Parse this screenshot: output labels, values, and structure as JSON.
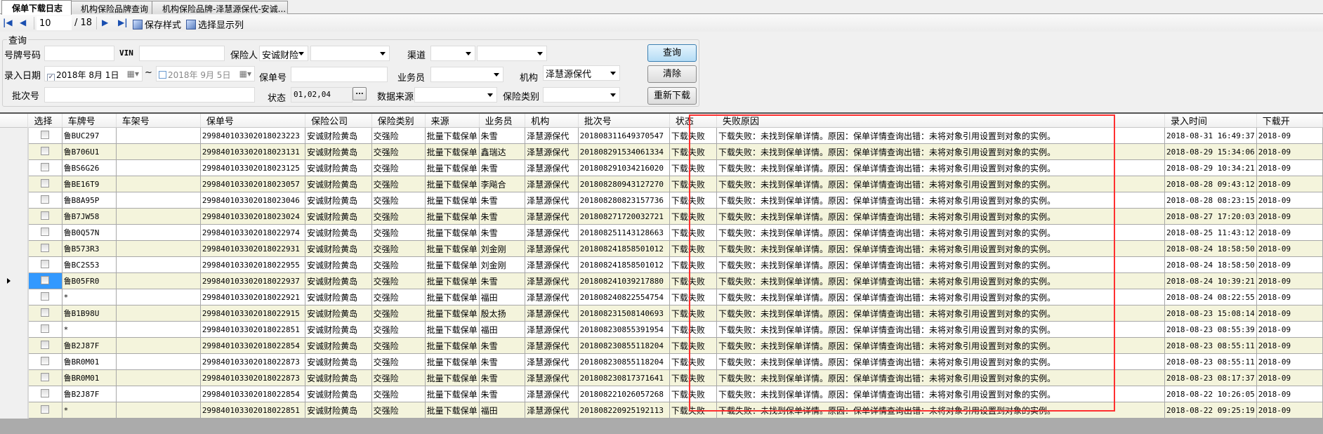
{
  "tabs": [
    {
      "label": "保单下载日志",
      "active": true
    },
    {
      "label": "机构保险品牌查询"
    },
    {
      "label": "机构保险品牌-泽慧源保代-安诚..."
    }
  ],
  "toolbar": {
    "current_page": "10",
    "total_pages": "/ 18",
    "save_style": "保存样式",
    "select_columns": "选择显示列"
  },
  "query": {
    "group_title": "查询",
    "plate_label": "号牌号码",
    "plate_value": "",
    "vin_label": "VIN",
    "vin_value": "",
    "insurer_label": "保险人",
    "insurer_value": "安诚财险",
    "insurer_sub_value": "",
    "channel_label": "渠道",
    "channel_value": "",
    "channel_sub_value": "",
    "entry_date_label": "录入日期",
    "date_from": "2018年  8月  1日",
    "date_from_checked": true,
    "tilde": "~",
    "date_to": "2018年  9月  5日",
    "date_to_checked": false,
    "policy_label": "保单号",
    "policy_value": "",
    "salesman_label": "业务员",
    "salesman_value": "",
    "org_label": "机构",
    "org_value": "泽慧源保代",
    "batch_label": "批次号",
    "batch_value": "",
    "status_label": "状态",
    "status_value": "01,02,04",
    "ellipsis": "...",
    "source_label": "数据来源",
    "source_value": "",
    "category_label": "保险类别",
    "category_value": "",
    "search_button": "查询",
    "clear_button": "清除",
    "redownload_button": "重新下载"
  },
  "grid": {
    "columns": [
      "选择",
      "车牌号",
      "车架号",
      "保单号",
      "保险公司",
      "保险类别",
      "来源",
      "业务员",
      "机构",
      "批次号",
      "状态",
      "失败原因",
      "录入时间",
      "下载开"
    ],
    "selected_row": 9,
    "rows": [
      [
        "鲁BUC297",
        "",
        "299840103302018023223",
        "安诚财险黄岛",
        "交强险",
        "批量下载保单",
        "朱雪",
        "泽慧源保代",
        "201808311649370547",
        "下载失败",
        "下载失败：未找到保单详情。原因：保单详情查询出错：未将对象引用设置到对象的实例。",
        "2018-08-31 16:49:37",
        "2018-09"
      ],
      [
        "鲁B706U1",
        "",
        "299840103302018023131",
        "安诚财险黄岛",
        "交强险",
        "批量下载保单",
        "鑫瑞达",
        "泽慧源保代",
        "201808291534061334",
        "下载失败",
        "下载失败：未找到保单详情。原因：保单详情查询出错：未将对象引用设置到对象的实例。",
        "2018-08-29 15:34:06",
        "2018-09"
      ],
      [
        "鲁BS6G26",
        "",
        "299840103302018023125",
        "安诚财险黄岛",
        "交强险",
        "批量下载保单",
        "朱雪",
        "泽慧源保代",
        "201808291034216020",
        "下载失败",
        "下载失败：未找到保单详情。原因：保单详情查询出错：未将对象引用设置到对象的实例。",
        "2018-08-29 10:34:21",
        "2018-09"
      ],
      [
        "鲁BE16T9",
        "",
        "299840103302018023057",
        "安诚财险黄岛",
        "交强险",
        "批量下载保单",
        "李飚合",
        "泽慧源保代",
        "201808280943127270",
        "下载失败",
        "下载失败：未找到保单详情。原因：保单详情查询出错：未将对象引用设置到对象的实例。",
        "2018-08-28 09:43:12",
        "2018-09"
      ],
      [
        "鲁B8A95P",
        "",
        "299840103302018023046",
        "安诚财险黄岛",
        "交强险",
        "批量下载保单",
        "朱雪",
        "泽慧源保代",
        "201808280823157736",
        "下载失败",
        "下载失败：未找到保单详情。原因：保单详情查询出错：未将对象引用设置到对象的实例。",
        "2018-08-28 08:23:15",
        "2018-09"
      ],
      [
        "鲁B7JW58",
        "",
        "299840103302018023024",
        "安诚财险黄岛",
        "交强险",
        "批量下载保单",
        "朱雪",
        "泽慧源保代",
        "201808271720032721",
        "下载失败",
        "下载失败：未找到保单详情。原因：保单详情查询出错：未将对象引用设置到对象的实例。",
        "2018-08-27 17:20:03",
        "2018-09"
      ],
      [
        "鲁B0Q57N",
        "",
        "299840103302018022974",
        "安诚财险黄岛",
        "交强险",
        "批量下载保单",
        "朱雪",
        "泽慧源保代",
        "201808251143128663",
        "下载失败",
        "下载失败：未找到保单详情。原因：保单详情查询出错：未将对象引用设置到对象的实例。",
        "2018-08-25 11:43:12",
        "2018-09"
      ],
      [
        "鲁B573R3",
        "",
        "299840103302018022931",
        "安诚财险黄岛",
        "交强险",
        "批量下载保单",
        "刘金刚",
        "泽慧源保代",
        "201808241858501012",
        "下载失败",
        "下载失败：未找到保单详情。原因：保单详情查询出错：未将对象引用设置到对象的实例。",
        "2018-08-24 18:58:50",
        "2018-09"
      ],
      [
        "鲁BC2S53",
        "",
        "299840103302018022955",
        "安诚财险黄岛",
        "交强险",
        "批量下载保单",
        "刘金刚",
        "泽慧源保代",
        "201808241858501012",
        "下载失败",
        "下载失败：未找到保单详情。原因：保单详情查询出错：未将对象引用设置到对象的实例。",
        "2018-08-24 18:58:50",
        "2018-09"
      ],
      [
        "鲁B05FR0",
        "",
        "299840103302018022937",
        "安诚财险黄岛",
        "交强险",
        "批量下载保单",
        "朱雪",
        "泽慧源保代",
        "201808241039217880",
        "下载失败",
        "下载失败：未找到保单详情。原因：保单详情查询出错：未将对象引用设置到对象的实例。",
        "2018-08-24 10:39:21",
        "2018-09"
      ],
      [
        "*",
        "",
        "299840103302018022921",
        "安诚财险黄岛",
        "交强险",
        "批量下载保单",
        "福田",
        "泽慧源保代",
        "201808240822554754",
        "下载失败",
        "下载失败：未找到保单详情。原因：保单详情查询出错：未将对象引用设置到对象的实例。",
        "2018-08-24 08:22:55",
        "2018-09"
      ],
      [
        "鲁B1B98U",
        "",
        "299840103302018022915",
        "安诚财险黄岛",
        "交强险",
        "批量下载保单",
        "殷太扬",
        "泽慧源保代",
        "201808231508140693",
        "下载失败",
        "下载失败：未找到保单详情。原因：保单详情查询出错：未将对象引用设置到对象的实例。",
        "2018-08-23 15:08:14",
        "2018-09"
      ],
      [
        "*",
        "",
        "299840103302018022851",
        "安诚财险黄岛",
        "交强险",
        "批量下载保单",
        "福田",
        "泽慧源保代",
        "201808230855391954",
        "下载失败",
        "下载失败：未找到保单详情。原因：保单详情查询出错：未将对象引用设置到对象的实例。",
        "2018-08-23 08:55:39",
        "2018-09"
      ],
      [
        "鲁B2J87F",
        "",
        "299840103302018022854",
        "安诚财险黄岛",
        "交强险",
        "批量下载保单",
        "朱雪",
        "泽慧源保代",
        "201808230855118204",
        "下载失败",
        "下载失败：未找到保单详情。原因：保单详情查询出错：未将对象引用设置到对象的实例。",
        "2018-08-23 08:55:11",
        "2018-09"
      ],
      [
        "鲁BR0M01",
        "",
        "299840103302018022873",
        "安诚财险黄岛",
        "交强险",
        "批量下载保单",
        "朱雪",
        "泽慧源保代",
        "201808230855118204",
        "下载失败",
        "下载失败：未找到保单详情。原因：保单详情查询出错：未将对象引用设置到对象的实例。",
        "2018-08-23 08:55:11",
        "2018-09"
      ],
      [
        "鲁BR0M01",
        "",
        "299840103302018022873",
        "安诚财险黄岛",
        "交强险",
        "批量下载保单",
        "朱雪",
        "泽慧源保代",
        "201808230817371641",
        "下载失败",
        "下载失败：未找到保单详情。原因：保单详情查询出错：未将对象引用设置到对象的实例。",
        "2018-08-23 08:17:37",
        "2018-09"
      ],
      [
        "鲁B2J87F",
        "",
        "299840103302018022854",
        "安诚财险黄岛",
        "交强险",
        "批量下载保单",
        "朱雪",
        "泽慧源保代",
        "201808221026057268",
        "下载失败",
        "下载失败：未找到保单详情。原因：保单详情查询出错：未将对象引用设置到对象的实例。",
        "2018-08-22 10:26:05",
        "2018-09"
      ],
      [
        "*",
        "",
        "299840103302018022851",
        "安诚财险黄岛",
        "交强险",
        "批量下载保单",
        "福田",
        "泽慧源保代",
        "201808220925192113",
        "下载失败",
        "下载失败：未找到保单详情。原因：保单详情查询出错：未将对象引用设置到对象的实例。",
        "2018-08-22 09:25:19",
        "2018-09"
      ]
    ]
  }
}
